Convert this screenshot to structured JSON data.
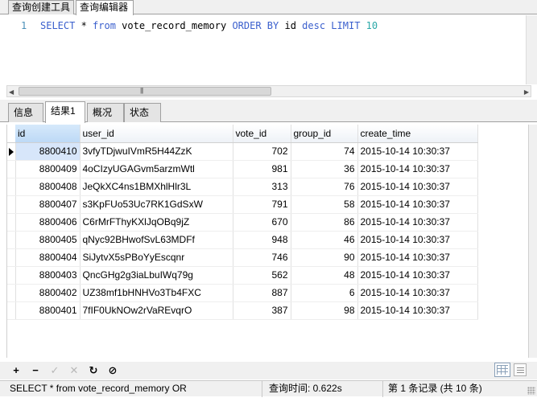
{
  "top_tabs": [
    {
      "label": "查询创建工具"
    },
    {
      "label": "查询编辑器"
    }
  ],
  "editor": {
    "line_number": "1",
    "tokens": {
      "select": "SELECT",
      "star": " * ",
      "from": "from",
      "table": " vote_record_memory ",
      "orderby": "ORDER BY",
      "col": " id ",
      "desc": "desc",
      "sp": " ",
      "limit": "LIMIT",
      "sp2": " ",
      "count": "10"
    }
  },
  "result_tabs": [
    {
      "label": "信息"
    },
    {
      "label": "结果1"
    },
    {
      "label": "概况"
    },
    {
      "label": "状态"
    }
  ],
  "grid": {
    "columns": [
      "id",
      "user_id",
      "vote_id",
      "group_id",
      "create_time"
    ],
    "rows": [
      [
        "8800410",
        "3vfyTDjwuIVmR5H44ZzK",
        "702",
        "74",
        "2015-10-14 10:30:37"
      ],
      [
        "8800409",
        "4oCIzyUGAGvm5arzmWtl",
        "981",
        "36",
        "2015-10-14 10:30:37"
      ],
      [
        "8800408",
        "JeQkXC4ns1BMXhlHlr3L",
        "313",
        "76",
        "2015-10-14 10:30:37"
      ],
      [
        "8800407",
        "s3KpFUo53Uc7RK1GdSxW",
        "791",
        "58",
        "2015-10-14 10:30:37"
      ],
      [
        "8800406",
        "C6rMrFThyKXlJqOBq9jZ",
        "670",
        "86",
        "2015-10-14 10:30:37"
      ],
      [
        "8800405",
        "qNyc92BHwofSvL63MDFf",
        "948",
        "46",
        "2015-10-14 10:30:37"
      ],
      [
        "8800404",
        "SiJytvX5sPBoYyEscqnr",
        "746",
        "90",
        "2015-10-14 10:30:37"
      ],
      [
        "8800403",
        "QncGHg2g3iaLbuIWq79g",
        "562",
        "48",
        "2015-10-14 10:30:37"
      ],
      [
        "8800402",
        "UZ38mf1bHNHVo3Tb4FXC",
        "887",
        "6",
        "2015-10-14 10:30:37"
      ],
      [
        "8800401",
        "7fIF0UkNOw2rVaREvqrO",
        "387",
        "98",
        "2015-10-14 10:30:37"
      ]
    ]
  },
  "toolbar": {
    "add": "+",
    "delete": "−",
    "apply": "✓",
    "cancel": "✕",
    "refresh": "↻",
    "stop": "⊘",
    "icons": [
      "plus-icon",
      "minus-icon",
      "check-icon",
      "cross-icon",
      "refresh-icon",
      "stop-icon",
      "grid-view-icon",
      "form-view-icon"
    ]
  },
  "status": {
    "query": "SELECT * from vote_record_memory OR",
    "time": "查询时间: 0.622s",
    "records": "第 1 条记录 (共 10 条)"
  },
  "colors": {
    "keyword": "#3a5fcd",
    "number": "#2ba8a8",
    "selected_cell": "#d7e6fa",
    "selected_header": "#bdd9f6"
  }
}
